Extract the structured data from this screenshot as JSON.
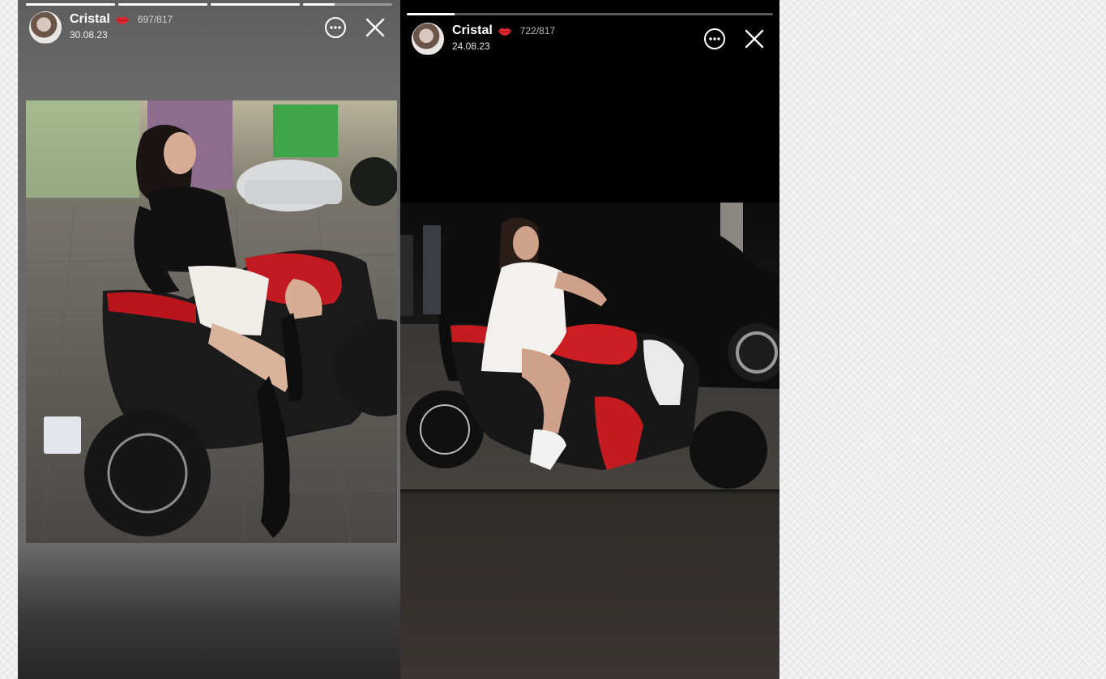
{
  "stories": [
    {
      "username": "Cristal",
      "views": "697/817",
      "date": "30.08.23",
      "icons": [
        "lips-icon",
        "more-icon",
        "close-icon"
      ],
      "progress": [
        1,
        1,
        1,
        0.35
      ]
    },
    {
      "username": "Cristal",
      "views": "722/817",
      "date": "24.08.23",
      "icons": [
        "lips-icon",
        "more-icon",
        "close-icon"
      ],
      "progress": [
        0.13
      ]
    }
  ]
}
